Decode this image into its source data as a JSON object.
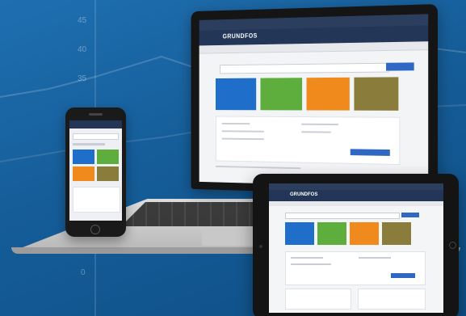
{
  "background_chart": {
    "y_ticks": [
      "45",
      "40",
      "35",
      "0"
    ],
    "color": "#1f6fb0"
  },
  "laptop": {
    "brand": "GRUNDFOS",
    "tiles": [
      {
        "color": "#1f6ec9"
      },
      {
        "color": "#5dae3c"
      },
      {
        "color": "#f08a1c"
      },
      {
        "color": "#8a7c3a"
      }
    ]
  },
  "phone": {
    "tiles": [
      {
        "color": "#1f6ec9"
      },
      {
        "color": "#5dae3c"
      },
      {
        "color": "#f08a1c"
      },
      {
        "color": "#8a7c3a"
      }
    ]
  },
  "tablet": {
    "brand": "GRUNDFOS",
    "tiles": [
      {
        "color": "#1f6ec9"
      },
      {
        "color": "#5dae3c"
      },
      {
        "color": "#f08a1c"
      },
      {
        "color": "#8a7c3a"
      }
    ]
  }
}
